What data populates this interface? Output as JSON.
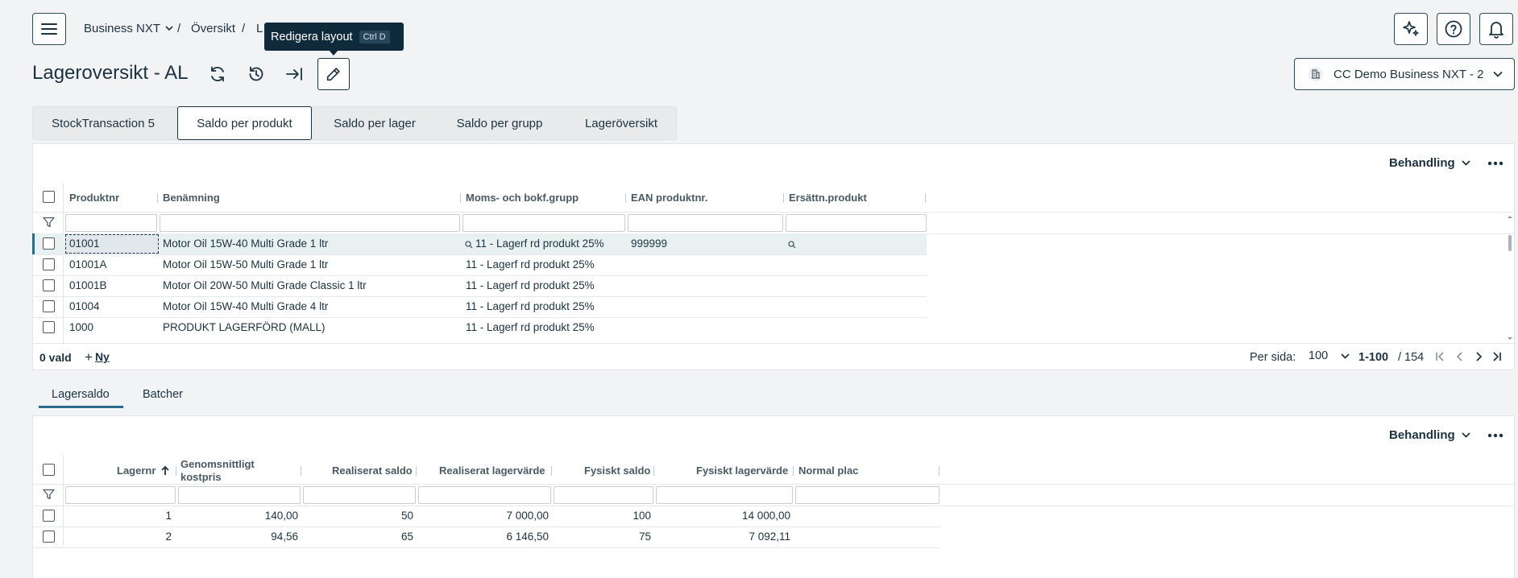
{
  "breadcrumb": {
    "company": "Business NXT",
    "sep1": "/",
    "overview": "Översikt",
    "sep2": "/",
    "current": "L"
  },
  "tooltip": {
    "label": "Redigera layout",
    "shortcut": "Ctrl D"
  },
  "page": {
    "title": "Lageroversikt - AL"
  },
  "company_selector": {
    "label": "CC Demo Business NXT - 2"
  },
  "tabs": [
    {
      "label": "StockTransaction 5"
    },
    {
      "label": "Saldo per produkt"
    },
    {
      "label": "Saldo per lager"
    },
    {
      "label": "Saldo per grupp"
    },
    {
      "label": "Lageröversikt"
    }
  ],
  "grid1": {
    "action_label": "Behandling",
    "columns": [
      "Produktnr",
      "Benämning",
      "Moms- och bokf.grupp",
      "EAN produktnr.",
      "Ersättn.produkt"
    ],
    "rows": [
      {
        "produktnr": "01001",
        "benamning": "Motor Oil 15W-40 Multi Grade 1 ltr",
        "moms": "11 - Lagerf rd produkt 25%",
        "ean": "999999"
      },
      {
        "produktnr": "01001A",
        "benamning": "Motor Oil 15W-50 Multi Grade 1 ltr",
        "moms": "11 - Lagerf rd produkt 25%",
        "ean": ""
      },
      {
        "produktnr": "01001B",
        "benamning": "Motor Oil 20W-50 Multi Grade Classic 1 ltr",
        "moms": "11 - Lagerf rd produkt 25%",
        "ean": ""
      },
      {
        "produktnr": "01004",
        "benamning": "Motor Oil 15W-40 Multi Grade 4 ltr",
        "moms": "11 - Lagerf rd produkt 25%",
        "ean": ""
      },
      {
        "produktnr": "1000",
        "benamning": "PRODUKT LAGERFÖRD (MALL)",
        "moms": "11 - Lagerf rd produkt 25%",
        "ean": ""
      }
    ],
    "footer": {
      "selected": "0 vald",
      "new_label": "Ny",
      "per_page_label": "Per sida:",
      "per_page_value": "100",
      "range": "1-100",
      "total": "/ 154"
    }
  },
  "subtabs": [
    {
      "label": "Lagersaldo"
    },
    {
      "label": "Batcher"
    }
  ],
  "grid2": {
    "action_label": "Behandling",
    "columns": {
      "lagernr": "Lagernr",
      "genomsnitt_1": "Genomsnittligt",
      "genomsnitt_2": "kostpris",
      "realiserat_saldo": "Realiserat saldo",
      "realiserat_varde": "Realiserat lagervärde",
      "fysiskt_saldo": "Fysiskt saldo",
      "fysiskt_varde": "Fysiskt lagervärde",
      "normal_plac": "Normal plac"
    },
    "rows": [
      {
        "lagernr": "1",
        "kostpris": "140,00",
        "realiserat_saldo": "50",
        "realiserat_varde": "7 000,00",
        "fysiskt_saldo": "100",
        "fysiskt_varde": "14 000,00"
      },
      {
        "lagernr": "2",
        "kostpris": "94,56",
        "realiserat_saldo": "65",
        "realiserat_varde": "6 146,50",
        "fysiskt_saldo": "75",
        "fysiskt_varde": "7 092,11"
      }
    ]
  },
  "colors": {
    "primary": "#1b3240",
    "selected_row": "#e8f1ef",
    "tooltip_bg": "#0f2a3b",
    "accent": "#2b6a8a"
  }
}
